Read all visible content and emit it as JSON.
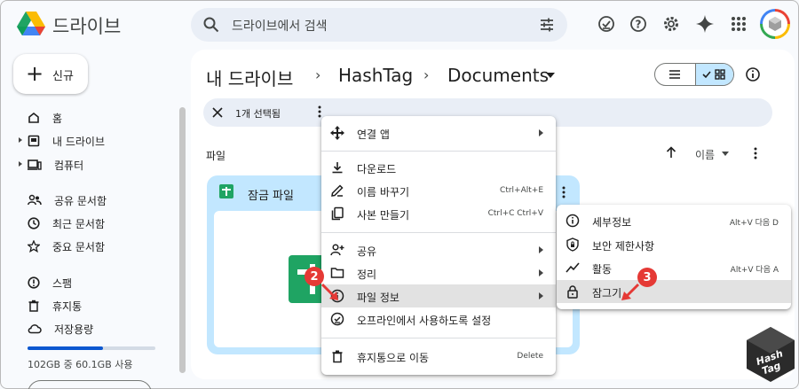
{
  "app": {
    "title": "드라이브"
  },
  "search": {
    "placeholder": "드라이브에서 검색"
  },
  "topbar": {
    "icons": [
      "offline-status-icon",
      "help-icon",
      "settings-icon",
      "gemini-spark-icon",
      "apps-grid-icon"
    ]
  },
  "sidebar": {
    "new_label": "신규",
    "items": [
      {
        "label": "홈",
        "icon": "home-icon"
      },
      {
        "label": "내 드라이브",
        "icon": "my-drive-icon"
      },
      {
        "label": "컴퓨터",
        "icon": "computer-icon"
      },
      {
        "label": "공유 문서함",
        "icon": "shared-icon"
      },
      {
        "label": "최근 문서함",
        "icon": "clock-icon"
      },
      {
        "label": "중요 문서함",
        "icon": "star-icon"
      },
      {
        "label": "스팸",
        "icon": "spam-icon"
      },
      {
        "label": "휴지통",
        "icon": "trash-icon"
      },
      {
        "label": "저장용량",
        "icon": "cloud-icon"
      }
    ],
    "storage_text": "102GB 중 60.1GB 사용",
    "storage_used_fraction": 0.59
  },
  "breadcrumb": {
    "root": "내 드라이브",
    "middle": "HashTag",
    "current": "Documents"
  },
  "selection": {
    "text": "1개 선택됨"
  },
  "main": {
    "section_label": "파일",
    "sort_label": "이름"
  },
  "file": {
    "name": "잠금 파일"
  },
  "context_menu": {
    "items": [
      {
        "label": "연결 앱",
        "shortcut": "",
        "submenu": true
      },
      {
        "label": "다운로드",
        "shortcut": ""
      },
      {
        "label": "이름 바꾸기",
        "shortcut": "Ctrl+Alt+E"
      },
      {
        "label": "사본 만들기",
        "shortcut": "Ctrl+C Ctrl+V"
      },
      {
        "label": "공유",
        "shortcut": "",
        "submenu": true
      },
      {
        "label": "정리",
        "shortcut": "",
        "submenu": true
      },
      {
        "label": "파일 정보",
        "shortcut": "",
        "submenu": true
      },
      {
        "label": "오프라인에서 사용하도록 설정",
        "shortcut": ""
      },
      {
        "label": "휴지통으로 이동",
        "shortcut": "Delete"
      }
    ]
  },
  "submenu": {
    "items": [
      {
        "label": "세부정보",
        "shortcut": "Alt+V 다음 D"
      },
      {
        "label": "보안 제한사항",
        "shortcut": ""
      },
      {
        "label": "활동",
        "shortcut": "Alt+V 다음 A"
      },
      {
        "label": "잠그기",
        "shortcut": ""
      }
    ]
  },
  "annotations": {
    "step2": "2",
    "step3": "3"
  },
  "watermark": {
    "line1": "Hash",
    "line2": "Tag"
  },
  "colors": {
    "accent": "#0b57d0",
    "selected": "#c2e7ff",
    "sheets_green": "#1fa463",
    "badge_red": "#e53935"
  }
}
